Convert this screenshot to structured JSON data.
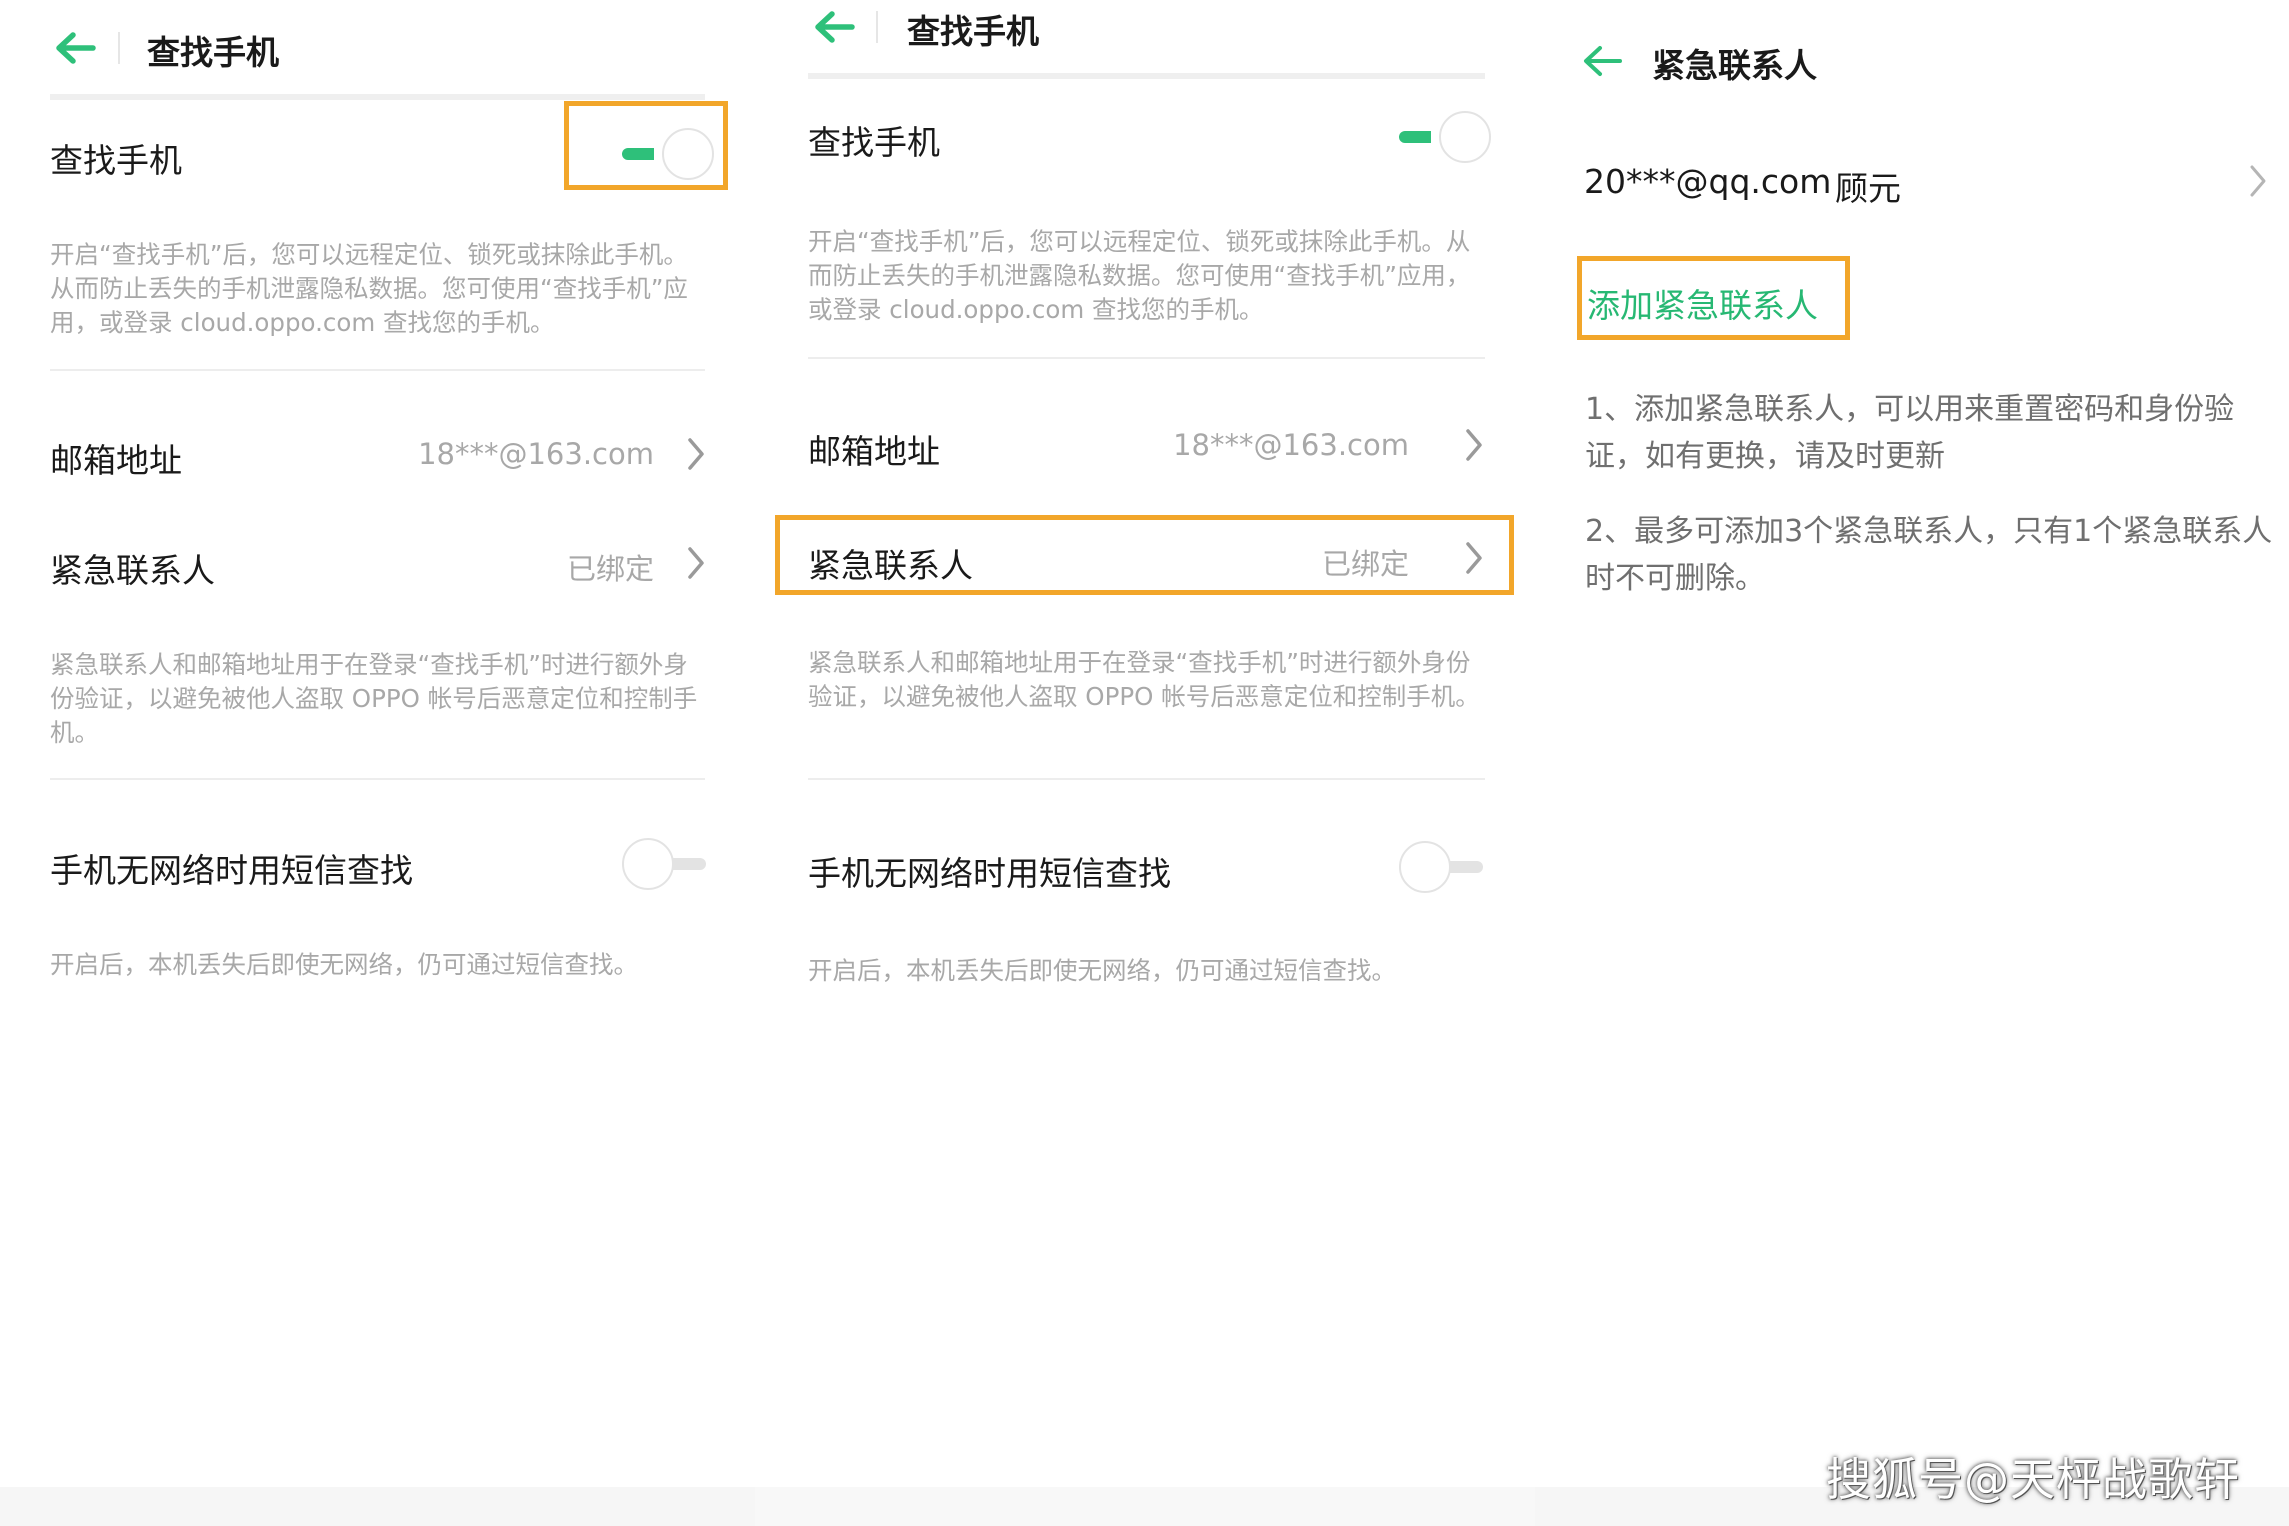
{
  "colors": {
    "accent_green": "#2ec07a",
    "highlight_orange": "#f2a62a",
    "secondary_text": "#a8a8a8"
  },
  "panel1": {
    "title": "查找手机",
    "find_phone_label": "查找手机",
    "find_phone_desc": "开启“查找手机”后，您可以远程定位、锁死或抹除此手机。从而防止丢失的手机泄露隐私数据。您可使用“查找手机”应用，或登录 cloud.oppo.com 查找您的手机。",
    "email_label": "邮箱地址",
    "email_value": "18***@163.com",
    "emergency_label": "紧急联系人",
    "emergency_value": "已绑定",
    "emergency_desc": "紧急联系人和邮箱地址用于在登录“查找手机”时进行额外身份验证，以避免被他人盗取 OPPO 帐号后恶意定位和控制手机。",
    "sms_label": "手机无网络时用短信查找",
    "sms_desc": "开启后，本机丢失后即使无网络，仍可通过短信查找。"
  },
  "panel2": {
    "title": "查找手机",
    "find_phone_label": "查找手机",
    "find_phone_desc": "开启“查找手机”后，您可以远程定位、锁死或抹除此手机。从而防止丢失的手机泄露隐私数据。您可使用“查找手机”应用，或登录 cloud.oppo.com 查找您的手机。",
    "email_label": "邮箱地址",
    "email_value": "18***@163.com",
    "emergency_label": "紧急联系人",
    "emergency_value": "已绑定",
    "emergency_desc": "紧急联系人和邮箱地址用于在登录“查找手机”时进行额外身份验证，以避免被他人盗取 OPPO 帐号后恶意定位和控制手机。",
    "sms_label": "手机无网络时用短信查找",
    "sms_desc": "开启后，本机丢失后即使无网络，仍可通过短信查找。"
  },
  "panel3": {
    "title": "紧急联系人",
    "contact_email": "20***@qq.com",
    "contact_name": "顾元",
    "add_contact": "添加紧急联系人",
    "note_1": "1、添加紧急联系人，可以用来重置密码和身份验证，如有更换，请及时更新",
    "note_2": "2、最多可添加3个紧急联系人，只有1个紧急联系人时不可删除。"
  },
  "watermark": "搜狐号@天枰战歌轩"
}
